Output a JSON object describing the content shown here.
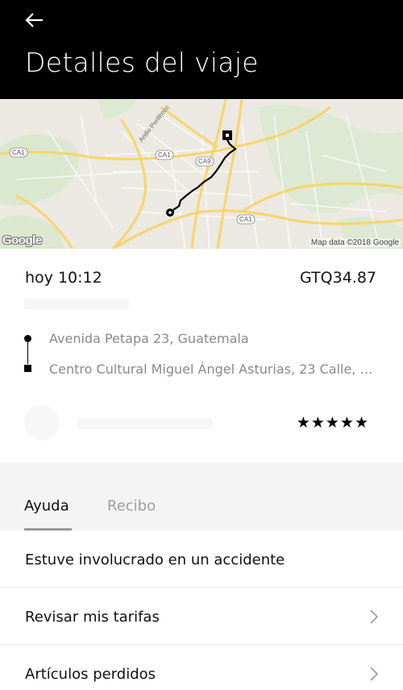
{
  "header": {
    "title": "Detalles del viaje",
    "back_icon": "arrow-left-icon"
  },
  "map": {
    "attribution": "Map data ©2018 Google",
    "logo": "Google",
    "road_labels": [
      "Anillo Periférico",
      "CA1",
      "CA1",
      "CA9",
      "CA1"
    ]
  },
  "trip": {
    "time": "hoy 10:12",
    "price": "GTQ34.87",
    "pickup": "Avenida Petapa 23, Guatemala",
    "dropoff": "Centro Cultural Miguel Ángel Asturias, 23 Calle, Gu…",
    "rating": "★★★★★"
  },
  "tabs": [
    {
      "label": "Ayuda",
      "active": true
    },
    {
      "label": "Recibo",
      "active": false
    }
  ],
  "help_items": [
    {
      "label": "Estuve involucrado en un accidente",
      "chevron": false
    },
    {
      "label": "Revisar mis tarifas",
      "chevron": true
    },
    {
      "label": "Artículos perdidos",
      "chevron": true
    }
  ],
  "colors": {
    "header_bg": "#000000",
    "map_bg": "#ece9e2",
    "road_major": "#f7d56a",
    "route": "#000000",
    "muted_text": "#8a8a8a",
    "section_bg": "#f4f4f4"
  }
}
